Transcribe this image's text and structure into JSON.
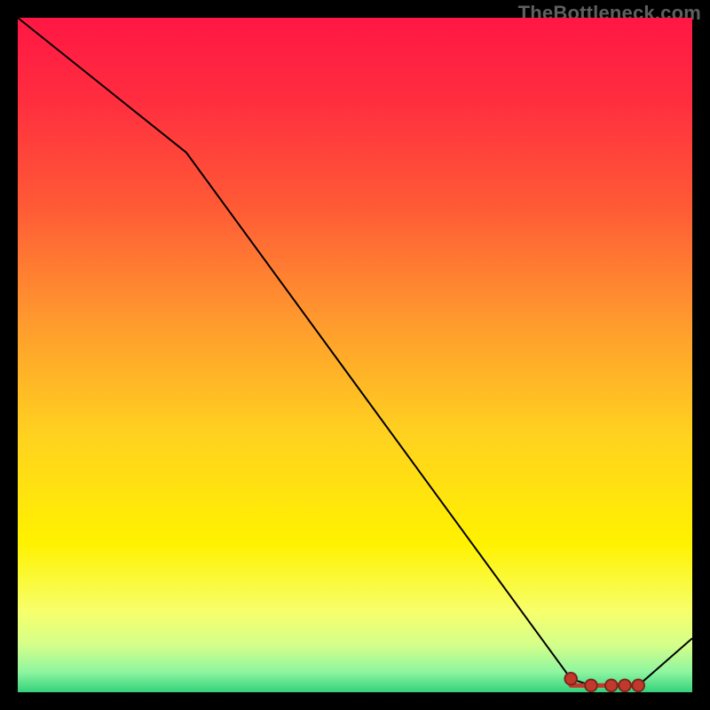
{
  "attribution": "TheBottleneck.com",
  "colors": {
    "gradient_stops": [
      {
        "offset": 0.0,
        "color": "#ff1744"
      },
      {
        "offset": 0.12,
        "color": "#ff2d3f"
      },
      {
        "offset": 0.28,
        "color": "#ff5a36"
      },
      {
        "offset": 0.45,
        "color": "#ff9a2e"
      },
      {
        "offset": 0.62,
        "color": "#ffd21f"
      },
      {
        "offset": 0.78,
        "color": "#fff200"
      },
      {
        "offset": 0.88,
        "color": "#f7ff6b"
      },
      {
        "offset": 0.93,
        "color": "#d4ff8a"
      },
      {
        "offset": 0.97,
        "color": "#8ef5a0"
      },
      {
        "offset": 1.0,
        "color": "#34d17c"
      }
    ],
    "line": "#000000",
    "marker_fill": "#c0392b",
    "marker_stroke": "#7b241c",
    "frame": "#000000",
    "attribution": "#5f5f5f"
  },
  "chart_data": {
    "type": "line",
    "title": "",
    "xlabel": "",
    "ylabel": "",
    "xlim": [
      0,
      100
    ],
    "ylim": [
      0,
      100
    ],
    "x": [
      0,
      25,
      82,
      85,
      88,
      90,
      92,
      100
    ],
    "y": [
      100,
      80,
      2,
      1,
      1,
      1,
      1,
      8
    ],
    "marker_x": [
      82,
      85,
      88,
      90,
      92
    ],
    "marker_y": [
      2,
      1,
      1,
      1,
      1
    ],
    "flat_band": {
      "x0": 82,
      "x1": 92,
      "y": 1
    }
  }
}
